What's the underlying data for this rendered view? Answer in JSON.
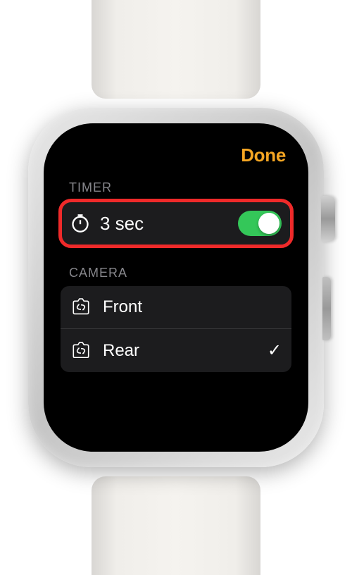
{
  "header": {
    "done_label": "Done"
  },
  "sections": {
    "timer": {
      "header": "TIMER",
      "row": {
        "label": "3 sec",
        "toggle_on": true
      }
    },
    "camera": {
      "header": "CAMERA",
      "options": [
        {
          "label": "Front",
          "selected": false
        },
        {
          "label": "Rear",
          "selected": true
        }
      ]
    }
  },
  "colors": {
    "accent": "#f5a623",
    "toggle_on": "#34c759",
    "highlight": "#ef2a2a"
  }
}
